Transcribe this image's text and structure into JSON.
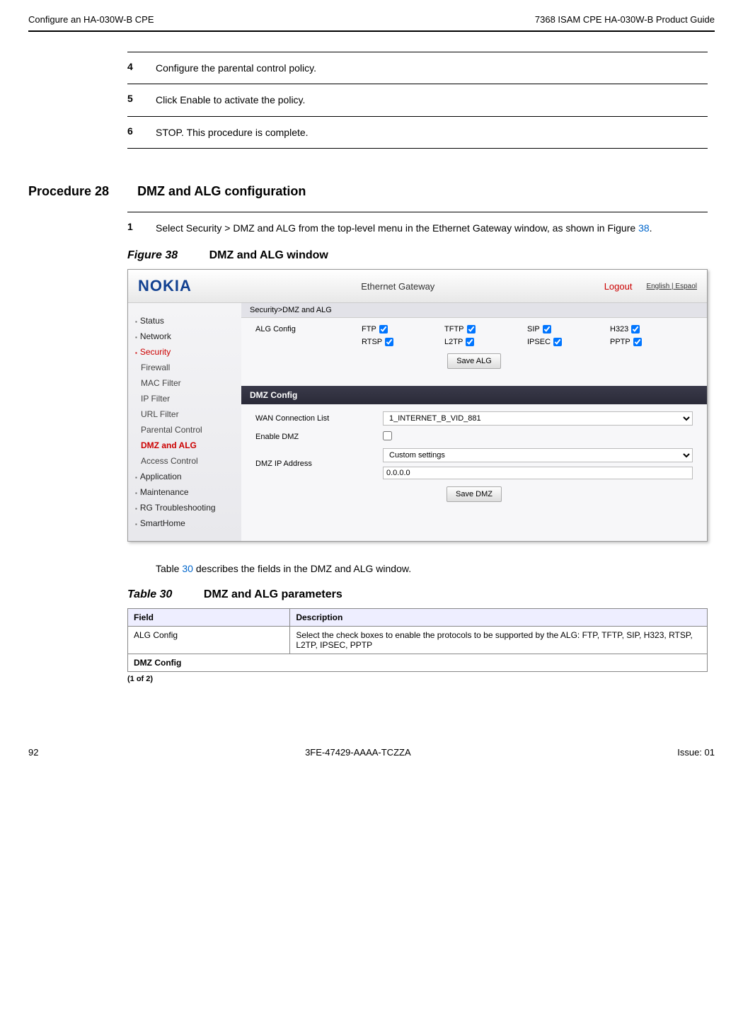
{
  "header": {
    "left": "Configure an HA-030W-B CPE",
    "right": "7368 ISAM CPE HA-030W-B Product Guide"
  },
  "steps_top": [
    {
      "num": "4",
      "text": "Configure the parental control policy."
    },
    {
      "num": "5",
      "text": "Click Enable to activate the policy."
    },
    {
      "num": "6",
      "text": "STOP. This procedure is complete."
    }
  ],
  "procedure": {
    "label": "Procedure 28",
    "title": "DMZ and ALG configuration"
  },
  "step1": {
    "num": "1",
    "prefix": "Select Security > DMZ and ALG from the top-level menu in the Ethernet Gateway window, as shown in Figure ",
    "link": "38",
    "suffix": "."
  },
  "figure": {
    "label": "Figure 38",
    "title": "DMZ and ALG window"
  },
  "screenshot": {
    "logo": "NOKIA",
    "title": "Ethernet Gateway",
    "logout": "Logout",
    "lang1": "English",
    "lang2": "Espaol",
    "crumb": "Security>DMZ and ALG",
    "sidebar": {
      "status": "Status",
      "network": "Network",
      "security": "Security",
      "firewall": "Firewall",
      "mac": "MAC Filter",
      "ip": "IP Filter",
      "url": "URL Filter",
      "parental": "Parental Control",
      "dmz": "DMZ and ALG",
      "access": "Access Control",
      "application": "Application",
      "maintenance": "Maintenance",
      "rg": "RG Troubleshooting",
      "smarthome": "SmartHome"
    },
    "alg": {
      "heading": "ALG Config",
      "ftp": "FTP",
      "tftp": "TFTP",
      "sip": "SIP",
      "h323": "H323",
      "rtsp": "RTSP",
      "l2tp": "L2TP",
      "ipsec": "IPSEC",
      "pptp": "PPTP",
      "save": "Save ALG"
    },
    "dmz": {
      "heading": "DMZ Config",
      "wan_label": "WAN Connection List",
      "wan_value": "1_INTERNET_B_VID_881",
      "enable_label": "Enable DMZ",
      "ip_label": "DMZ IP Address",
      "ip_select": "Custom settings",
      "ip_value": "0.0.0.0",
      "save": "Save DMZ"
    }
  },
  "table_intro": {
    "prefix": "Table ",
    "link": "30",
    "suffix": " describes the fields in the DMZ and ALG window."
  },
  "table": {
    "label": "Table 30",
    "title": "DMZ and ALG parameters",
    "h1": "Field",
    "h2": "Description",
    "r1c1": "ALG Config",
    "r1c2": "Select the check boxes to enable the protocols to be supported by the ALG: FTP, TFTP, SIP, H323, RTSP, L2TP, IPSEC, PPTP",
    "r2": "DMZ Config",
    "pager": "(1 of 2)"
  },
  "footer": {
    "page": "92",
    "doc": "3FE-47429-AAAA-TCZZA",
    "issue": "Issue: 01"
  }
}
